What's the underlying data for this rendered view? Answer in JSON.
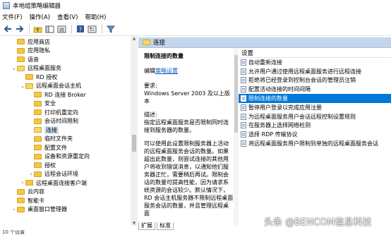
{
  "window": {
    "title": "本地组策略编辑器"
  },
  "menu": [
    "文件(F)",
    "操作(A)",
    "查看(V)",
    "帮助(H)"
  ],
  "toolbar": {
    "icons": [
      "back-arrow-icon",
      "forward-arrow-icon",
      "folder-up-icon",
      "show-hide-tree-icon",
      "export-list-icon",
      "help-icon",
      "properties-icon",
      "filter-icon"
    ]
  },
  "tree": [
    {
      "label": "应用商店",
      "depth": 3
    },
    {
      "label": "应用隐私",
      "depth": 3
    },
    {
      "label": "语音",
      "depth": 3
    },
    {
      "label": "远程桌面服务",
      "depth": 3,
      "expander": "v"
    },
    {
      "label": "RD 授权",
      "depth": 4
    },
    {
      "label": "远程桌面会话主机",
      "depth": 4,
      "expander": "v"
    },
    {
      "label": "RD 连接 Broker",
      "depth": 5
    },
    {
      "label": "安全",
      "depth": 5
    },
    {
      "label": "打印机重定向",
      "depth": 5
    },
    {
      "label": "会话时间限制",
      "depth": 5
    },
    {
      "label": "连接",
      "depth": 5,
      "selected": true
    },
    {
      "label": "临时文件夹",
      "depth": 5
    },
    {
      "label": "配置文件",
      "depth": 5
    },
    {
      "label": "设备和资源重定向",
      "depth": 5
    },
    {
      "label": "授权",
      "depth": 5
    },
    {
      "label": "远程会话环境",
      "depth": 5,
      "expander": ">"
    },
    {
      "label": "远程桌面连接客户端",
      "depth": 4,
      "expander": ">"
    },
    {
      "label": "云内容",
      "depth": 3
    },
    {
      "label": "智能卡",
      "depth": 3
    },
    {
      "label": "桌面窗口管理器",
      "depth": 3,
      "expander": ">"
    }
  ],
  "pane": {
    "header": "连接",
    "description": {
      "heading": "限制连接的数量",
      "edit_prefix": "编辑",
      "edit_link": "策略设置",
      "requirements_label": "要求:",
      "requirements": "Windows Server 2003 及以上版本",
      "desc_label": "描述:",
      "desc_text": "指定远程桌面服务是否限制同时连接到服务器的数量。",
      "body": "可以使用此设置限制服务器上活动的远程桌面服务会话的数量。如果超出此数量，则尝试连接的其他用户将收到错误消息，以通知他们服务器正忙，需要稍后再试。限制会话的数量可提高性能，因为请求系统资源的会话较少。默认情况下，RD 会话主机服务器不限制远程桌面服务会话的数量，并且管理远程桌面"
    },
    "settings_header": "设置",
    "settings": [
      {
        "label": "自动重新连接"
      },
      {
        "label": "允许用户通过使用远程桌面服务进行远程连接"
      },
      {
        "label": "拒绝将已经登录到控制台会话的管理员注销"
      },
      {
        "label": "配置活动连接的时间间隔"
      },
      {
        "label": "限制连接的数量",
        "selected": true
      },
      {
        "label": "暂停用户登录以完成应用注册"
      },
      {
        "label": "为远程桌面服务用户会话远程控制设置规则"
      },
      {
        "label": "在服务器上选择网络检测"
      },
      {
        "label": "选择 RDP 传输协议"
      },
      {
        "label": "将远程桌面服务用户限制到单独的远程桌面服务会话"
      }
    ],
    "tabs": [
      "扩展",
      "标准"
    ]
  },
  "statusbar": {
    "text": "10 个设置"
  },
  "watermark": "头条 @BENCOM信息科技"
}
